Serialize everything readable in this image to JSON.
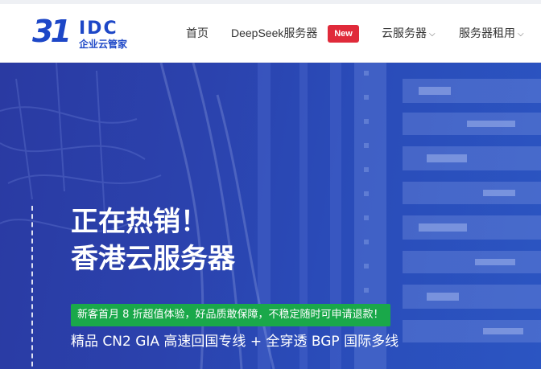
{
  "header": {
    "logo": {
      "number": "31",
      "letters": "IDC",
      "tagline": "企业云管家"
    },
    "nav": [
      {
        "label": "首页"
      },
      {
        "label": "DeepSeek服务器",
        "badge": "New"
      },
      {
        "label": "云服务器",
        "has_dropdown": true
      },
      {
        "label": "服务器租用",
        "has_dropdown": true
      }
    ]
  },
  "hero": {
    "title_line1": "正在热销！",
    "title_line2": "香港云服务器",
    "promo": "新客首月 8 折超值体验，好品质敢保障，不稳定随时可申请退款！",
    "subline": "精品 CN2 GIA 高速回国专线 + 全穿透 BGP 国际多线"
  },
  "colors": {
    "brand": "#1d47c7",
    "hero_bg": "#2b42ad",
    "badge": "#e02a3a",
    "promo_bg": "#1aa84a"
  },
  "icons": {
    "dropdown": "chevron-down-icon"
  }
}
